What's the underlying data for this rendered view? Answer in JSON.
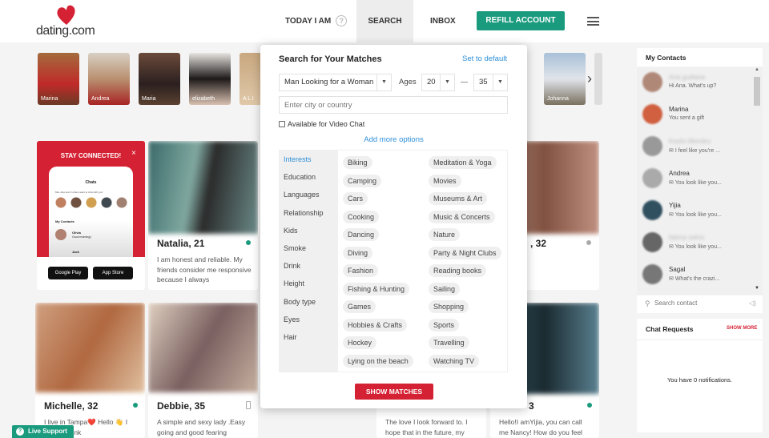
{
  "header": {
    "logo": "dating.com",
    "nav": [
      "TODAY I AM",
      "SEARCH",
      "INBOX"
    ],
    "help_icon": "?",
    "refill": "REFILL ACCOUNT",
    "accent": "#1b9b7e",
    "brand": "#d42133"
  },
  "stories": [
    "Marina",
    "Andrea",
    "Maria",
    "elizabeth",
    "A L I",
    "Johanna"
  ],
  "promo": {
    "title": "STAY CONNECTED!",
    "close": "×",
    "phone_title": "Chats",
    "phone_sub": "Mia, Alex and 4 others want to chat with you!",
    "phone_contacts": "My Contacts",
    "c1": "Olivia",
    "c1m": "Good morning:)",
    "c2": "Jack",
    "google": "Google Play",
    "apple": "App Store"
  },
  "cards": [
    {
      "name": "Natalia, 21",
      "desc": "I am honest and reliable. My friends consider me responsive because I always"
    },
    {
      "name": ", 32",
      "desc": ""
    },
    {
      "name": "Michelle, 32",
      "desc": "I live in Tampa❤️ Hello 👋 I always think"
    },
    {
      "name": "Debbie, 35",
      "desc": "A simple and sexy lady .Easy going and good fearing"
    },
    {
      "name": "",
      "desc": "The love I look forward to. I hope that in the future, my"
    },
    {
      "name": "3",
      "desc": "Hello!I amYijia, you can call me Nancy! How do you feel"
    }
  ],
  "search": {
    "title": "Search for Your Matches",
    "reset": "Set to default",
    "looking": "Man Looking for a Woman",
    "ages_label": "Ages",
    "age_from": "20",
    "dash": "—",
    "age_to": "35",
    "city_placeholder": "Enter city or country",
    "video_chat": "Available for Video Chat",
    "video_checked": false,
    "more": "Add more options",
    "categories": [
      "Interests",
      "Education",
      "Languages",
      "Relationship",
      "Kids",
      "Smoke",
      "Drink",
      "Height",
      "Body type",
      "Eyes",
      "Hair"
    ],
    "active_category": "Interests",
    "tags_left": [
      "Biking",
      "Camping",
      "Cars",
      "Cooking",
      "Dancing",
      "Diving",
      "Fashion",
      "Fishing & Hunting",
      "Games",
      "Hobbies & Crafts",
      "Hockey",
      "Lying on the beach"
    ],
    "tags_right": [
      "Meditation & Yoga",
      "Movies",
      "Museums & Art",
      "Music & Concerts",
      "Nature",
      "Party & Night Clubs",
      "Reading books",
      "Sailing",
      "Shopping",
      "Sports",
      "Travelling",
      "Watching TV"
    ],
    "submit": "SHOW MATCHES"
  },
  "contacts": {
    "title": "My Contacts",
    "items": [
      {
        "name": "Ana gudiana",
        "msg": "Hi Ana. What's up?",
        "blur": true
      },
      {
        "name": "Marina",
        "msg": "You sent a gift",
        "blur": false
      },
      {
        "name": "Keylin Mendez",
        "msg": "I feel like you're ...",
        "blur": true
      },
      {
        "name": "Andrea",
        "msg": "You look like you...",
        "blur": false
      },
      {
        "name": "Yijia",
        "msg": "You look like you...",
        "blur": false
      },
      {
        "name": "fatima zahra",
        "msg": "You look like you...",
        "blur": true
      },
      {
        "name": "Sagal",
        "msg": "What's the crazi...",
        "blur": false
      }
    ],
    "search_placeholder": "Search contact"
  },
  "requests": {
    "title": "Chat Requests",
    "more": "SHOW MORE",
    "empty": "You have 0 notifications."
  },
  "live": "Live Support"
}
